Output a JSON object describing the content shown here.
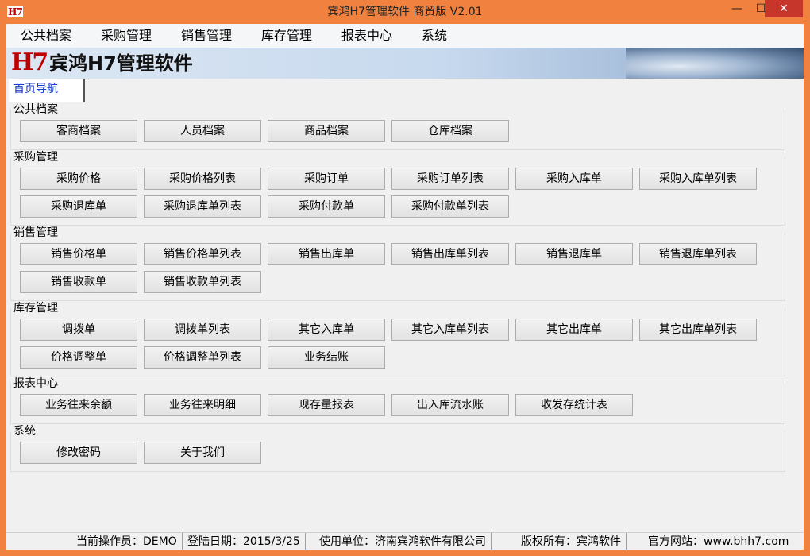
{
  "window": {
    "icon_text": "H7",
    "title": "宾鸿H7管理软件 商贸版 V2.01",
    "min_glyph": "—",
    "max_glyph": "☐",
    "close_glyph": "✕"
  },
  "menu": [
    "公共档案",
    "采购管理",
    "销售管理",
    "库存管理",
    "报表中心",
    "系统"
  ],
  "banner": {
    "logo": "H7",
    "title": "宾鸿H7管理软件"
  },
  "tabs": [
    "首页导航"
  ],
  "groups": [
    {
      "title": "公共档案",
      "buttons": [
        "客商档案",
        "人员档案",
        "商品档案",
        "仓库档案"
      ]
    },
    {
      "title": "采购管理",
      "buttons": [
        "采购价格",
        "采购价格列表",
        "采购订单",
        "采购订单列表",
        "采购入库单",
        "采购入库单列表",
        "采购退库单",
        "采购退库单列表",
        "采购付款单",
        "采购付款单列表"
      ]
    },
    {
      "title": "销售管理",
      "buttons": [
        "销售价格单",
        "销售价格单列表",
        "销售出库单",
        "销售出库单列表",
        "销售退库单",
        "销售退库单列表",
        "销售收款单",
        "销售收款单列表"
      ]
    },
    {
      "title": "库存管理",
      "buttons": [
        "调拨单",
        "调拨单列表",
        "其它入库单",
        "其它入库单列表",
        "其它出库单",
        "其它出库单列表",
        "价格调整单",
        "价格调整单列表",
        "业务结账"
      ]
    },
    {
      "title": "报表中心",
      "buttons": [
        "业务往来余额",
        "业务往来明细",
        "现存量报表",
        "出入库流水账",
        "收发存统计表"
      ]
    },
    {
      "title": "系统",
      "buttons": [
        "修改密码",
        "关于我们"
      ]
    }
  ],
  "status": {
    "operator": "当前操作员：DEMO",
    "login_date": "登陆日期：2015/3/25",
    "company": "使用单位：济南宾鸿软件有限公司",
    "copyright": "版权所有：宾鸿软件",
    "website": "官方网站：www.bhh7.com"
  }
}
